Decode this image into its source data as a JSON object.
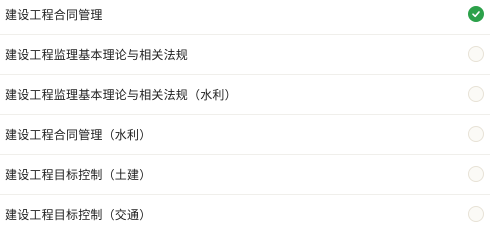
{
  "options": [
    {
      "label": "建设工程合同管理",
      "selected": true
    },
    {
      "label": "建设工程监理基本理论与相关法规",
      "selected": false
    },
    {
      "label": "建设工程监理基本理论与相关法规（水利）",
      "selected": false
    },
    {
      "label": "建设工程合同管理（水利）",
      "selected": false
    },
    {
      "label": "建设工程目标控制（土建）",
      "selected": false
    },
    {
      "label": "建设工程目标控制（交通）",
      "selected": false
    }
  ],
  "colors": {
    "selected": "#2ca14a",
    "unselected_border": "#e7e2d6"
  },
  "icons": {
    "selected": "checkmark-icon"
  }
}
